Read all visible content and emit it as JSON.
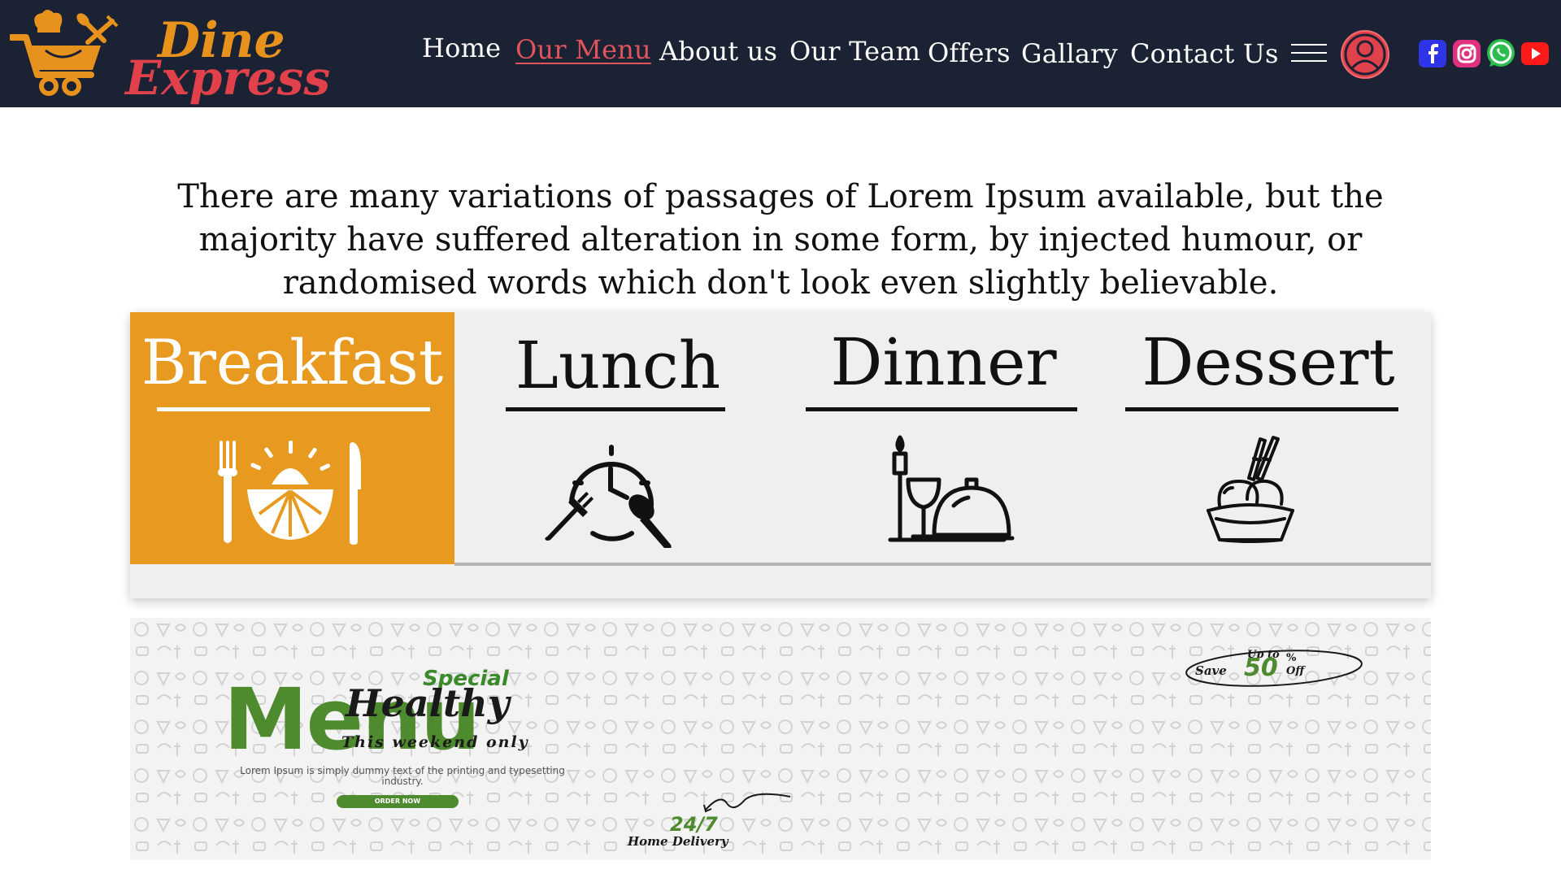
{
  "brand": {
    "line1": "Dine",
    "line2": "Express"
  },
  "nav": {
    "items": [
      {
        "label": "Home"
      },
      {
        "label": "Our Menu",
        "active": true
      },
      {
        "label": "About us"
      },
      {
        "label": "Our Team"
      },
      {
        "label": "Offers"
      },
      {
        "label": "Gallary"
      },
      {
        "label": "Contact Us"
      }
    ],
    "icons": [
      "menu-icon",
      "user-icon",
      "facebook-icon",
      "instagram-icon",
      "whatsapp-icon",
      "youtube-icon"
    ]
  },
  "intro": {
    "text": "There are many variations of passages of Lorem Ipsum available, but the majority have suffered alteration in some form, by injected humour, or randomised words which don't look even slightly believable."
  },
  "tabs": [
    {
      "label": "Breakfast",
      "icon": "breakfast-icon",
      "active": true
    },
    {
      "label": "Lunch",
      "icon": "lunch-clock-icon"
    },
    {
      "label": "Dinner",
      "icon": "dinner-cloche-icon"
    },
    {
      "label": "Dessert",
      "icon": "ice-cream-icon"
    }
  ],
  "banner": {
    "special": "Special",
    "healthy": "Healthy",
    "menu": "Menu",
    "weekend": "This weekend only",
    "lorem": "Lorem Ipsum is simply dummy text of the printing and typesetting industry.",
    "order_button": "ORDER NOW",
    "offer": {
      "up_to": "Up to",
      "save": "Save",
      "amount": "50",
      "percent": "%",
      "off": "Off"
    },
    "hours": "24/7",
    "delivery": "Home Delivery"
  },
  "colors": {
    "header_bg": "#1b2233",
    "accent_orange": "#e89a20",
    "active_link": "#e0545c",
    "tab_bg": "#efefef",
    "banner_green": "#4e8a2e"
  }
}
